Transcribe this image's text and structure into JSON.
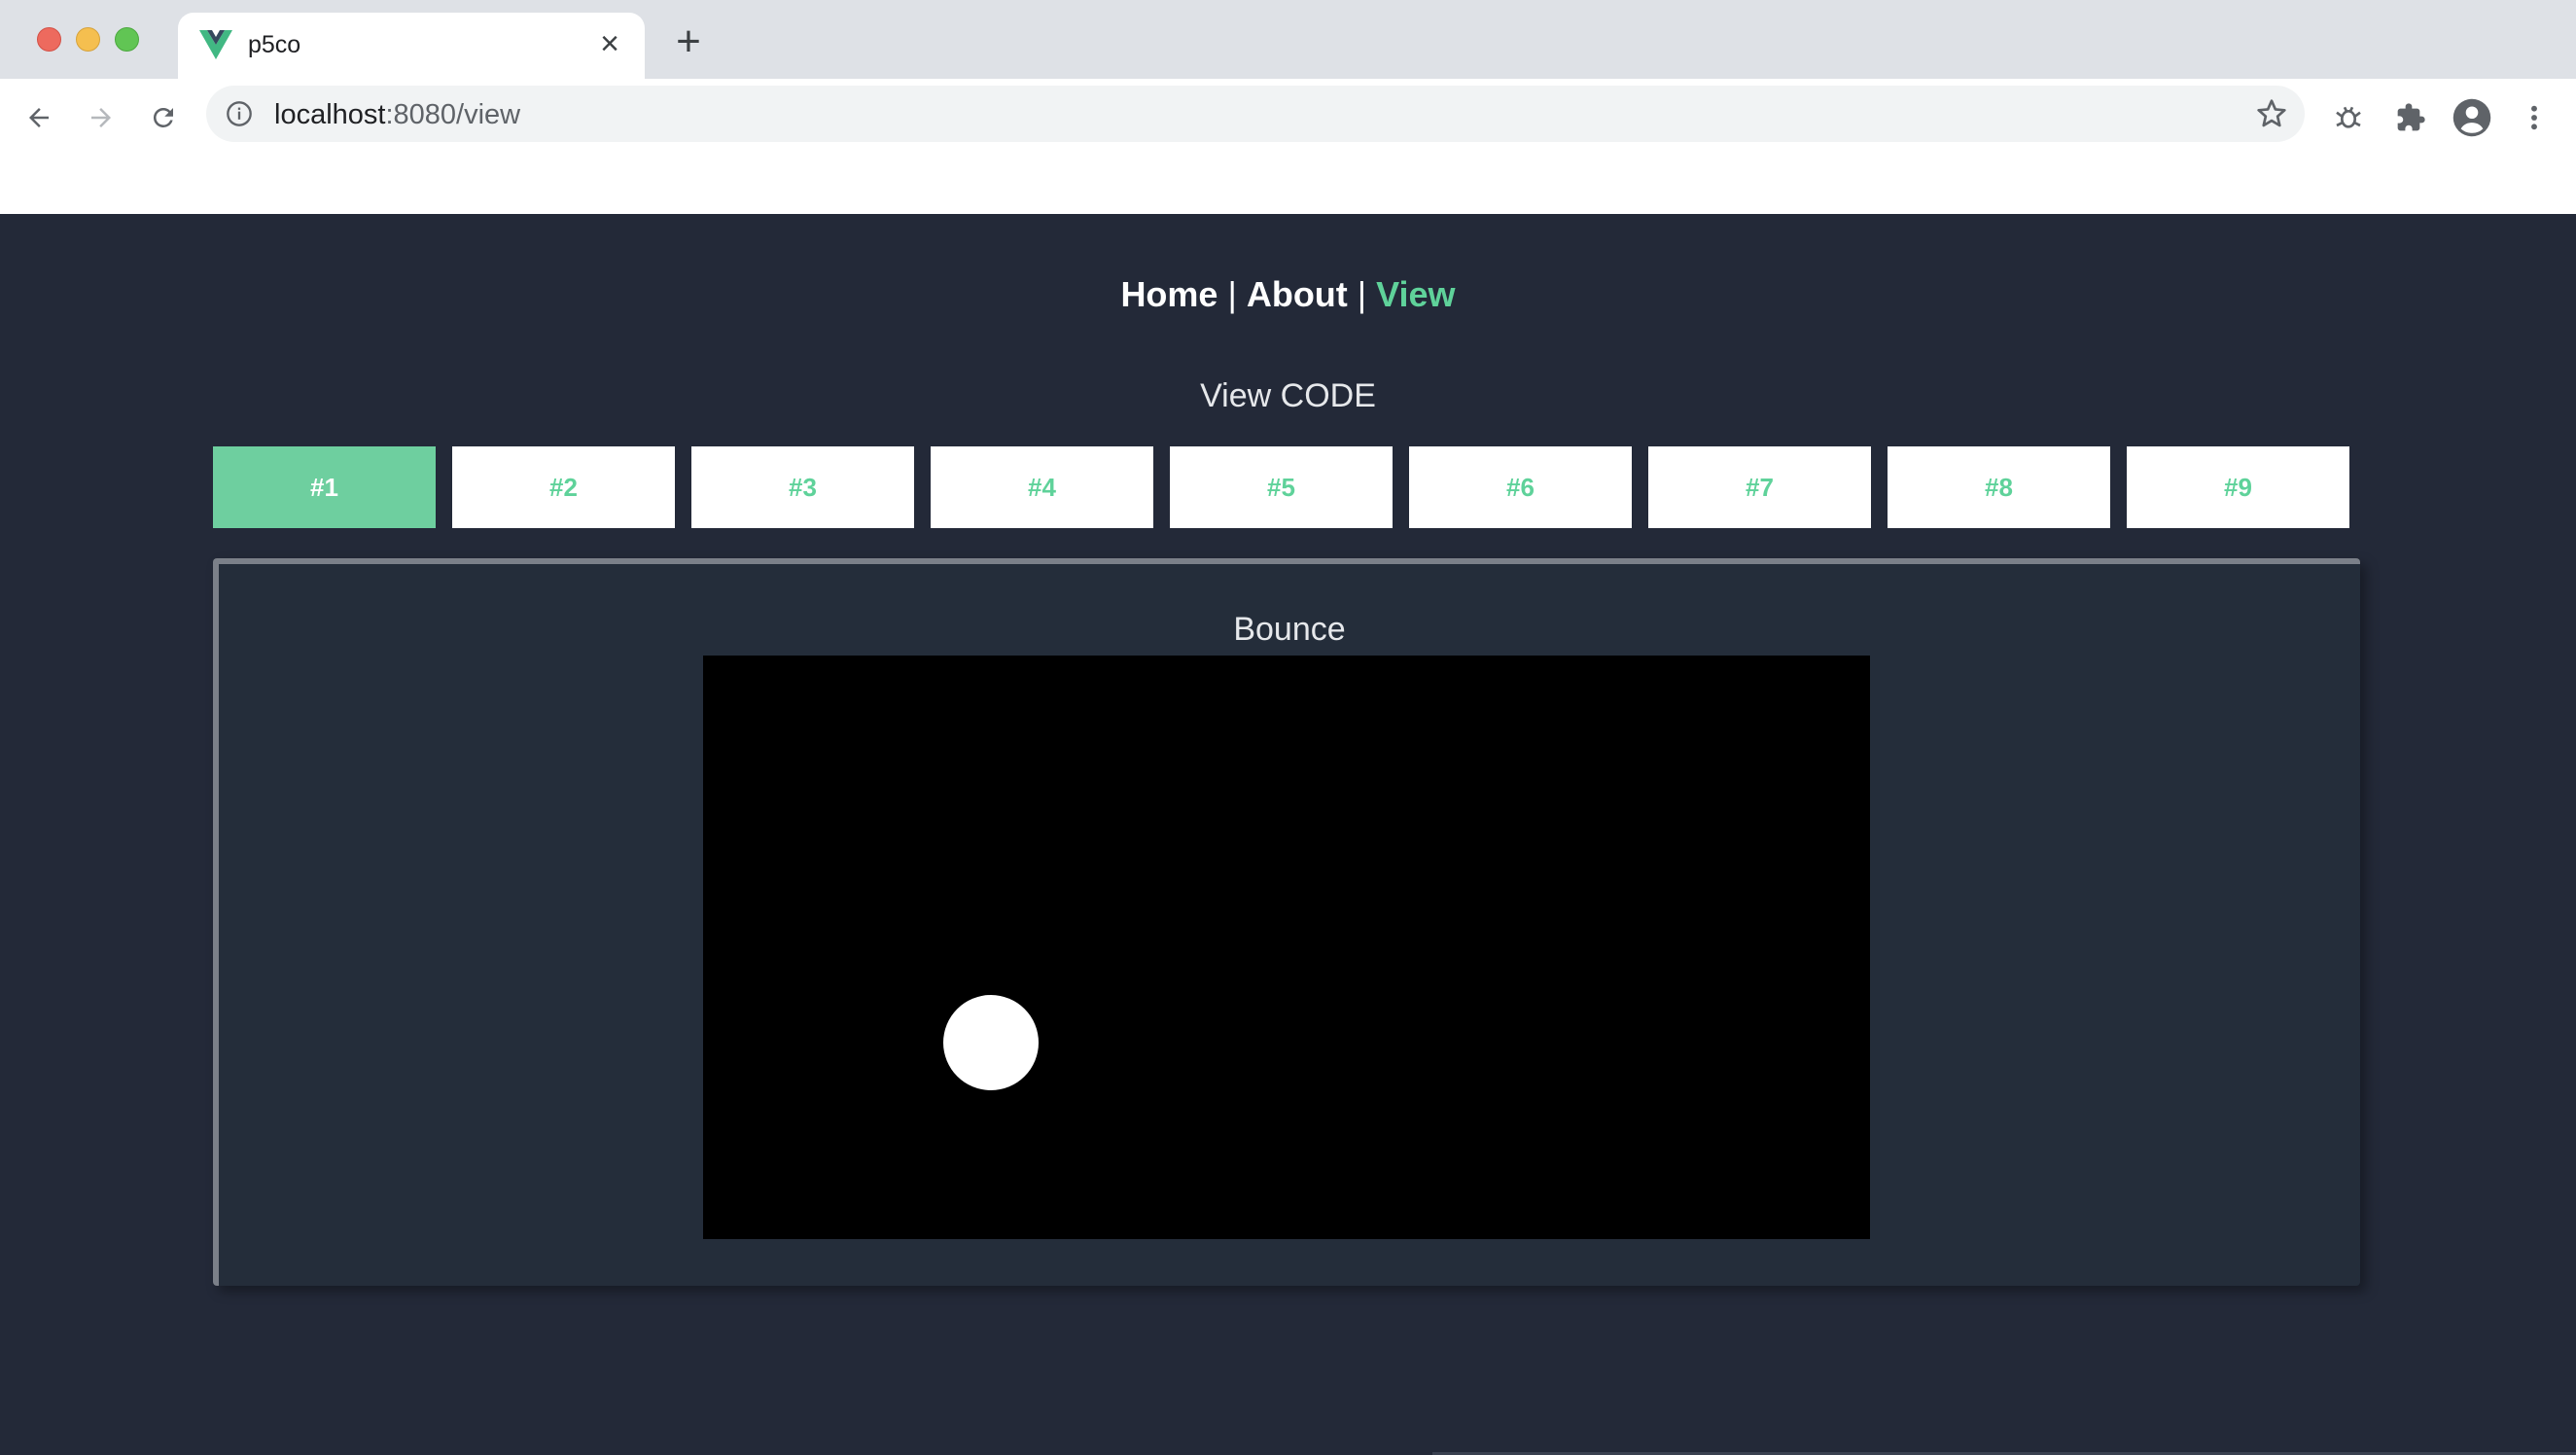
{
  "browser": {
    "tab_title": "p5co",
    "url_host": "localhost",
    "url_rest": ":8080/view"
  },
  "nav": {
    "home": "Home",
    "about": "About",
    "view": "View",
    "separator": "|",
    "active_color": "#5fd29a"
  },
  "heading": "View CODE",
  "buttons": [
    "#1",
    "#2",
    "#3",
    "#4",
    "#5",
    "#6",
    "#7",
    "#8",
    "#9"
  ],
  "selected_button": "#1",
  "panel": {
    "title": "Bounce",
    "canvas_bg": "#000000",
    "ball_color": "#ffffff"
  },
  "colors": {
    "page_bg": "#232938",
    "accent": "#5fd29a",
    "active_button_bg": "#6ecf9f"
  }
}
